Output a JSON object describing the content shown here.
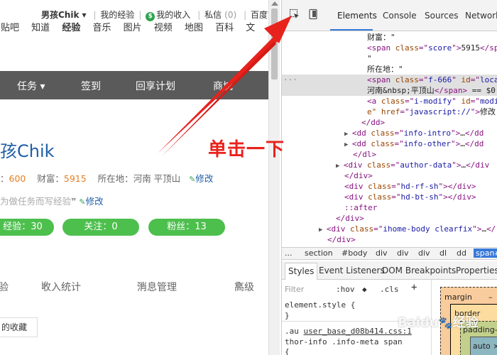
{
  "webpage": {
    "userbar": {
      "username": "男孩Chik",
      "dropdown_glyph": "▾",
      "my_experience": "我的经验",
      "coin_glyph": "$",
      "my_income": "我的收入",
      "messages": "私信",
      "messages_count": "(0)",
      "baidu_home": "百度首页"
    },
    "nav": [
      "贴吧",
      "知道",
      "经验",
      "音乐",
      "图片",
      "视频",
      "地图",
      "百科",
      "文"
    ],
    "nav_active": "经验",
    "menu_bar": [
      "任务 ▾",
      "签到",
      "回享计划",
      "商城"
    ],
    "profile": {
      "name": "孩Chik",
      "level_value": "600",
      "wealth_label": "财富：",
      "wealth_value": "5915",
      "location_label": "所在地：",
      "location_value": "河南 平顶山",
      "edit": "修改",
      "level_prefix": "：",
      "signature": "为做任务而写经验",
      "signature_quote": "❞"
    },
    "stats": [
      "经验：30",
      "关注：0",
      "粉丝：13"
    ],
    "tabs": [
      "验",
      "收入统计",
      "消息管理",
      "高级"
    ],
    "favorites": "的收藏"
  },
  "annotation": {
    "text": "单击一下",
    "color": "#e8221c"
  },
  "devtools": {
    "tabs": [
      "Elements",
      "Console",
      "Sources",
      "Network"
    ],
    "active_tab": "Elements",
    "dom_lines": [
      {
        "indent": 120,
        "parts": [
          [
            "txt",
            "财富：\""
          ]
        ]
      },
      {
        "indent": 120,
        "parts": [
          [
            "tag",
            "<span "
          ],
          [
            "attr",
            "class"
          ],
          [
            "tag",
            "=\""
          ],
          [
            "val",
            "score"
          ],
          [
            "tag",
            "\">"
          ],
          [
            "txt",
            "5915"
          ],
          [
            "tag",
            "</sp"
          ]
        ]
      },
      {
        "indent": 120,
        "parts": [
          [
            "txt",
            "\""
          ]
        ]
      },
      {
        "indent": 120,
        "parts": [
          [
            "txt",
            "所在地：\""
          ]
        ]
      },
      {
        "indent": 120,
        "selected": true,
        "parts": [
          [
            "tag",
            "<span "
          ],
          [
            "attr",
            "class"
          ],
          [
            "tag",
            "=\""
          ],
          [
            "val",
            "f-666"
          ],
          [
            "tag",
            "\" "
          ],
          [
            "attr",
            "id"
          ],
          [
            "tag",
            "=\""
          ],
          [
            "val",
            "loca"
          ]
        ]
      },
      {
        "indent": 120,
        "selected": true,
        "parts": [
          [
            "txt",
            "河南&nbsp;平顶山"
          ],
          [
            "tag",
            "</span>"
          ],
          [
            "txt",
            " == $0"
          ]
        ]
      },
      {
        "indent": 120,
        "parts": [
          [
            "tag",
            "<a "
          ],
          [
            "attr",
            "class"
          ],
          [
            "tag",
            "=\""
          ],
          [
            "val",
            "i-modify"
          ],
          [
            "tag",
            "\" "
          ],
          [
            "attr",
            "id"
          ],
          [
            "tag",
            "=\""
          ],
          [
            "val",
            "modi"
          ]
        ]
      },
      {
        "indent": 120,
        "parts": [
          [
            "attr",
            "e\" href"
          ],
          [
            "tag",
            "=\""
          ],
          [
            "val",
            "javascript://"
          ],
          [
            "tag",
            "\">"
          ],
          [
            "txt",
            "修改"
          ]
        ]
      },
      {
        "indent": 112,
        "parts": [
          [
            "tag",
            "</dd>"
          ]
        ]
      },
      {
        "indent": 100,
        "tri": "▶",
        "parts": [
          [
            "tag",
            "<dd "
          ],
          [
            "attr",
            "class"
          ],
          [
            "tag",
            "=\""
          ],
          [
            "val",
            "info-intro"
          ],
          [
            "tag",
            "\">"
          ],
          [
            "txt",
            "…"
          ],
          [
            "tag",
            "</dd"
          ]
        ]
      },
      {
        "indent": 100,
        "tri": "▶",
        "parts": [
          [
            "tag",
            "<dd "
          ],
          [
            "attr",
            "class"
          ],
          [
            "tag",
            "=\""
          ],
          [
            "val",
            "info-other"
          ],
          [
            "tag",
            "\">"
          ],
          [
            "txt",
            "…"
          ],
          [
            "tag",
            "</dd"
          ]
        ]
      },
      {
        "indent": 100,
        "parts": [
          [
            "tag",
            "</dl>"
          ]
        ]
      },
      {
        "indent": 88,
        "tri": "▶",
        "parts": [
          [
            "tag",
            "<div "
          ],
          [
            "attr",
            "class"
          ],
          [
            "tag",
            "=\""
          ],
          [
            "val",
            "author-data"
          ],
          [
            "tag",
            "\">"
          ],
          [
            "txt",
            "…"
          ],
          [
            "tag",
            "</div"
          ]
        ]
      },
      {
        "indent": 88,
        "parts": [
          [
            "tag",
            "</div>"
          ]
        ]
      },
      {
        "indent": 88,
        "parts": [
          [
            "tag",
            "<div "
          ],
          [
            "attr",
            "class"
          ],
          [
            "tag",
            "=\""
          ],
          [
            "val",
            "hd-rf-sh"
          ],
          [
            "tag",
            "\"></div>"
          ]
        ]
      },
      {
        "indent": 88,
        "parts": [
          [
            "tag",
            "<div "
          ],
          [
            "attr",
            "class"
          ],
          [
            "tag",
            "=\""
          ],
          [
            "val",
            "hd-bt-sh"
          ],
          [
            "tag",
            "\"></div>"
          ]
        ]
      },
      {
        "indent": 88,
        "parts": [
          [
            "tag",
            "::after"
          ]
        ]
      },
      {
        "indent": 76,
        "parts": [
          [
            "tag",
            "</div>"
          ]
        ]
      },
      {
        "indent": 64,
        "tri": "▶",
        "parts": [
          [
            "tag",
            "<div "
          ],
          [
            "attr",
            "class"
          ],
          [
            "tag",
            "=\""
          ],
          [
            "val",
            "ihome-body clearfix"
          ],
          [
            "tag",
            "\">"
          ],
          [
            "txt",
            "…"
          ],
          [
            "tag",
            "</"
          ]
        ]
      },
      {
        "indent": 64,
        "parts": [
          [
            "tag",
            "</div>"
          ]
        ]
      },
      {
        "indent": 52,
        "parts": [
          [
            "tag",
            "</section>"
          ]
        ]
      }
    ],
    "breadcrumbs": [
      "...",
      "section",
      "#body",
      "div",
      "div",
      "div",
      "dl",
      "dd",
      "span#"
    ],
    "styles_tabs": [
      "Styles",
      "Event Listeners",
      "DOM Breakpoints",
      "Properties"
    ],
    "styles": {
      "filter_placeholder": "Filter",
      "hov": ":hov",
      "cls": ".cls",
      "plus": "+",
      "element_style": "element.style {",
      "close_brace": "}",
      "rule_selector_prefix": ".au ",
      "rule_file": "user_base_d08b414.css:1",
      "rule_selector": "thor-info .info-meta span",
      "open_brace": "{"
    },
    "box_model": {
      "margin": "margin",
      "margin_value": "–",
      "border": "border",
      "padding": "padding-",
      "content": "auto ×"
    }
  },
  "watermark": {
    "brand": "Baidu",
    "suffix": "经验"
  }
}
